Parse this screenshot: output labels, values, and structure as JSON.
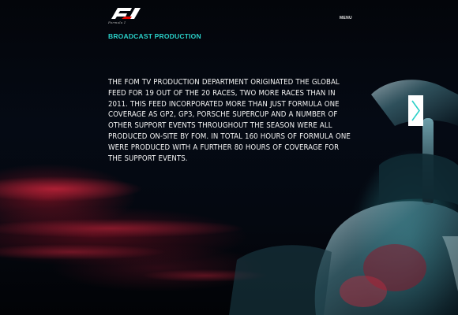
{
  "header": {
    "logo_tagline": "Formula 1",
    "menu_label": "MENU"
  },
  "section": {
    "title": "BROADCAST PRODUCTION",
    "body": "THE FOM TV PRODUCTION DEPARTMENT ORIGINATED THE GLOBAL FEED FOR 19 OUT OF THE 20 RACES, TWO MORE RACES THAN IN 2011. THIS FEED INCORPORATED MORE THAN JUST FORMULA ONE COVERAGE AS GP2, GP3, PORSCHE SUPERCUP AND A NUMBER OF OTHER SUPPORT EVENTS THROUGHOUT THE SEASON WERE ALL PRODUCED ON-SITE BY FOM. IN TOTAL 160 HOURS OF FORMULA ONE WERE PRODUCED WITH A FURTHER 80 HOURS OF COVERAGE FOR THE SUPPORT EVENTS."
  },
  "navigation": {
    "next_icon": "chevron-right-icon"
  },
  "colors": {
    "accent": "#2ad0c8",
    "background": "#03050a",
    "text": "#f2f2f2"
  }
}
